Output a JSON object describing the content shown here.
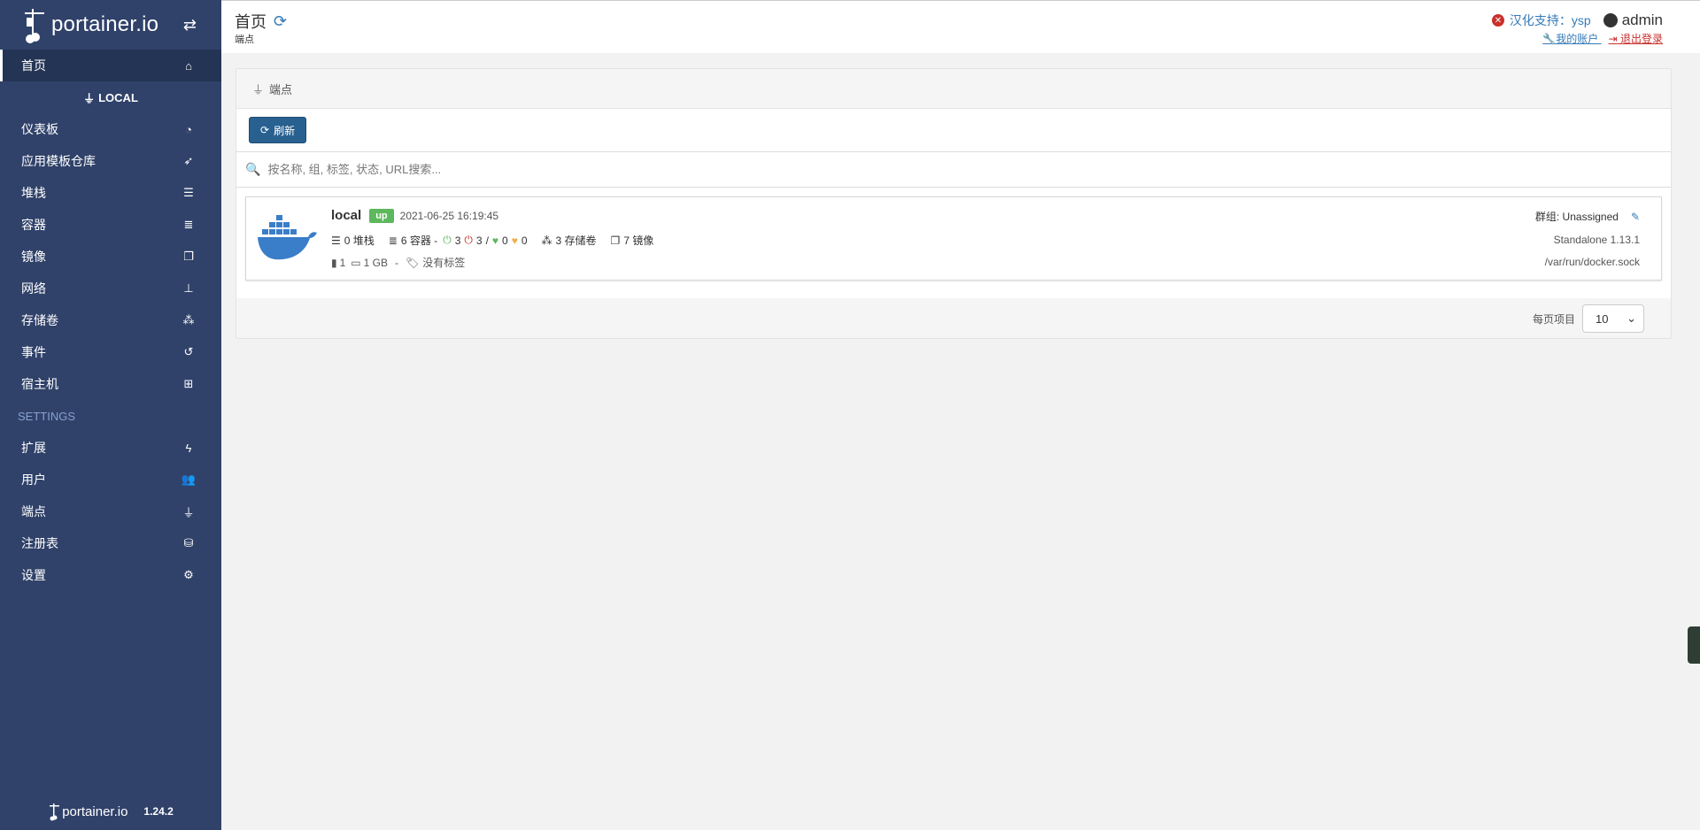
{
  "brand": {
    "name": "portainer.io"
  },
  "sidebar": {
    "home": "首页",
    "endpoint_name": "LOCAL",
    "items": [
      {
        "label": "仪表板",
        "icon": "tachometer-icon"
      },
      {
        "label": "应用模板仓库",
        "icon": "rocket-icon"
      },
      {
        "label": "堆栈",
        "icon": "th-list-icon"
      },
      {
        "label": "容器",
        "icon": "server-icon"
      },
      {
        "label": "镜像",
        "icon": "clone-icon"
      },
      {
        "label": "网络",
        "icon": "sitemap-icon"
      },
      {
        "label": "存储卷",
        "icon": "cubes-icon"
      },
      {
        "label": "事件",
        "icon": "history-icon"
      },
      {
        "label": "宿主机",
        "icon": "th-icon"
      }
    ],
    "settings_title": "SETTINGS",
    "settings_items": [
      {
        "label": "扩展",
        "icon": "bolt-icon"
      },
      {
        "label": "用户",
        "icon": "users-icon"
      },
      {
        "label": "端点",
        "icon": "plug-icon"
      },
      {
        "label": "注册表",
        "icon": "database-icon"
      },
      {
        "label": "设置",
        "icon": "cogs-icon"
      }
    ],
    "footer_version": "1.24.2"
  },
  "header": {
    "title": "首页",
    "subtitle": "端点",
    "support_text": "汉化支持：",
    "support_name": "ysp",
    "username": "admin",
    "my_account": "我的账户",
    "logout": "退出登录"
  },
  "widget": {
    "title": "端点",
    "refresh_button": "刷新",
    "search_placeholder": "按名称, 组, 标签, 状态, URL搜索...",
    "items_per_page_label": "每页项目",
    "items_per_page_value": "10"
  },
  "endpoint": {
    "name": "local",
    "status": "up",
    "timestamp": "2021-06-25 16:19:45",
    "stacks": "0 堆栈",
    "containers": "6 容器 -",
    "running": "3",
    "stopped": "3",
    "separator": "/",
    "healthy": "0",
    "unhealthy": "0",
    "volumes": "3 存储卷",
    "images": "7 镜像",
    "cpu": "1",
    "memory": "1 GB",
    "dash": "-",
    "tags": "没有标签",
    "group": "群组: Unassigned",
    "type": "Standalone 1.13.1",
    "url": "/var/run/docker.sock"
  },
  "colors": {
    "sidebar_bg": "#30426a",
    "primary": "#337ab7",
    "success": "#5cb85c",
    "danger": "#c9302c"
  }
}
